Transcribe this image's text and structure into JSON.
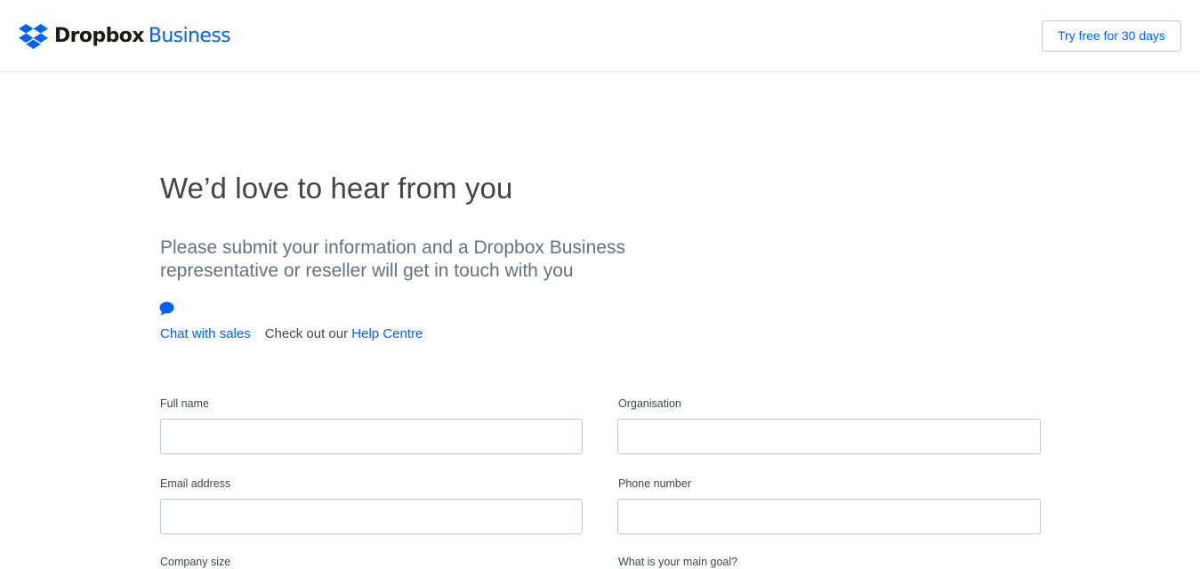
{
  "header": {
    "logo_brand": "Dropbox",
    "logo_product": "Business",
    "cta_label": "Try free for 30 days"
  },
  "hero": {
    "title": "We’d love to hear from you",
    "subtitle": "Please submit your information and a Dropbox Business representative or reseller will get in touch with you"
  },
  "contact": {
    "chat_icon": "speech-bubble-icon",
    "chat_label": "Chat with sales",
    "help_prefix": "Check out our",
    "help_link": "Help Centre"
  },
  "form": {
    "full_name": {
      "label": "Full name",
      "value": ""
    },
    "organisation": {
      "label": "Organisation",
      "value": ""
    },
    "email": {
      "label": "Email address",
      "value": ""
    },
    "phone": {
      "label": "Phone number",
      "value": ""
    },
    "row3_left_label": "Company size",
    "row3_right_label": "What is your main goal?"
  },
  "colors": {
    "accent": "#0061fe",
    "text": "#3d464d",
    "muted": "#637282",
    "border": "#c1c7cd"
  }
}
